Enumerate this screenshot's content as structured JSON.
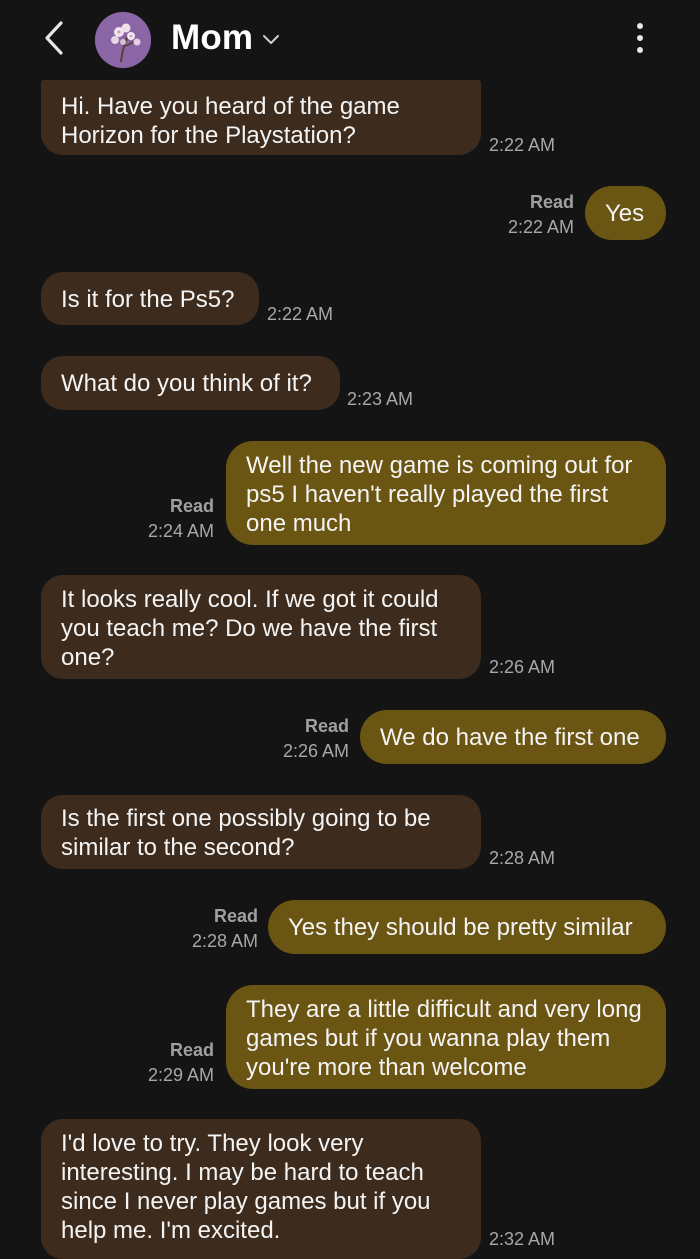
{
  "header": {
    "title": "Mom",
    "back_icon": "chevron-left-icon",
    "dropdown_icon": "chevron-down-icon",
    "menu_icon": "more-vert-icon"
  },
  "colors": {
    "background": "#141414",
    "incoming_bubble": "#3d2c1e",
    "outgoing_bubble": "#6a5513",
    "timestamp": "#a8a8a8"
  },
  "messages": [
    {
      "direction": "incoming",
      "text": "Hi. Have you heard of the game Horizon for the Playstation?",
      "time": "2:22 AM"
    },
    {
      "direction": "outgoing",
      "text": "Yes",
      "status": "Read",
      "time": "2:22 AM"
    },
    {
      "direction": "incoming",
      "text": "Is it for the Ps5?",
      "time": "2:22 AM"
    },
    {
      "direction": "incoming",
      "text": "What do you think of it?",
      "time": "2:23 AM"
    },
    {
      "direction": "outgoing",
      "text": "Well the new game is coming out for ps5 I haven't really played the first one much",
      "status": "Read",
      "time": "2:24 AM"
    },
    {
      "direction": "incoming",
      "text": "It looks really cool. If we got it could you teach me? Do we have the first one?",
      "time": "2:26 AM"
    },
    {
      "direction": "outgoing",
      "text": "We do have the first one",
      "status": "Read",
      "time": "2:26 AM"
    },
    {
      "direction": "incoming",
      "text": "Is the first one possibly going to be similar to the second?",
      "time": "2:28 AM"
    },
    {
      "direction": "outgoing",
      "text": "Yes they should be pretty similar",
      "status": "Read",
      "time": "2:28 AM"
    },
    {
      "direction": "outgoing",
      "text": "They are a little difficult and very long games but if you wanna play them you're more than welcome",
      "status": "Read",
      "time": "2:29 AM"
    },
    {
      "direction": "incoming",
      "text": "I'd love to try. They look very interesting. I may be hard to teach since I never play games but if you help me. I'm excited.",
      "time": "2:32 AM"
    }
  ]
}
